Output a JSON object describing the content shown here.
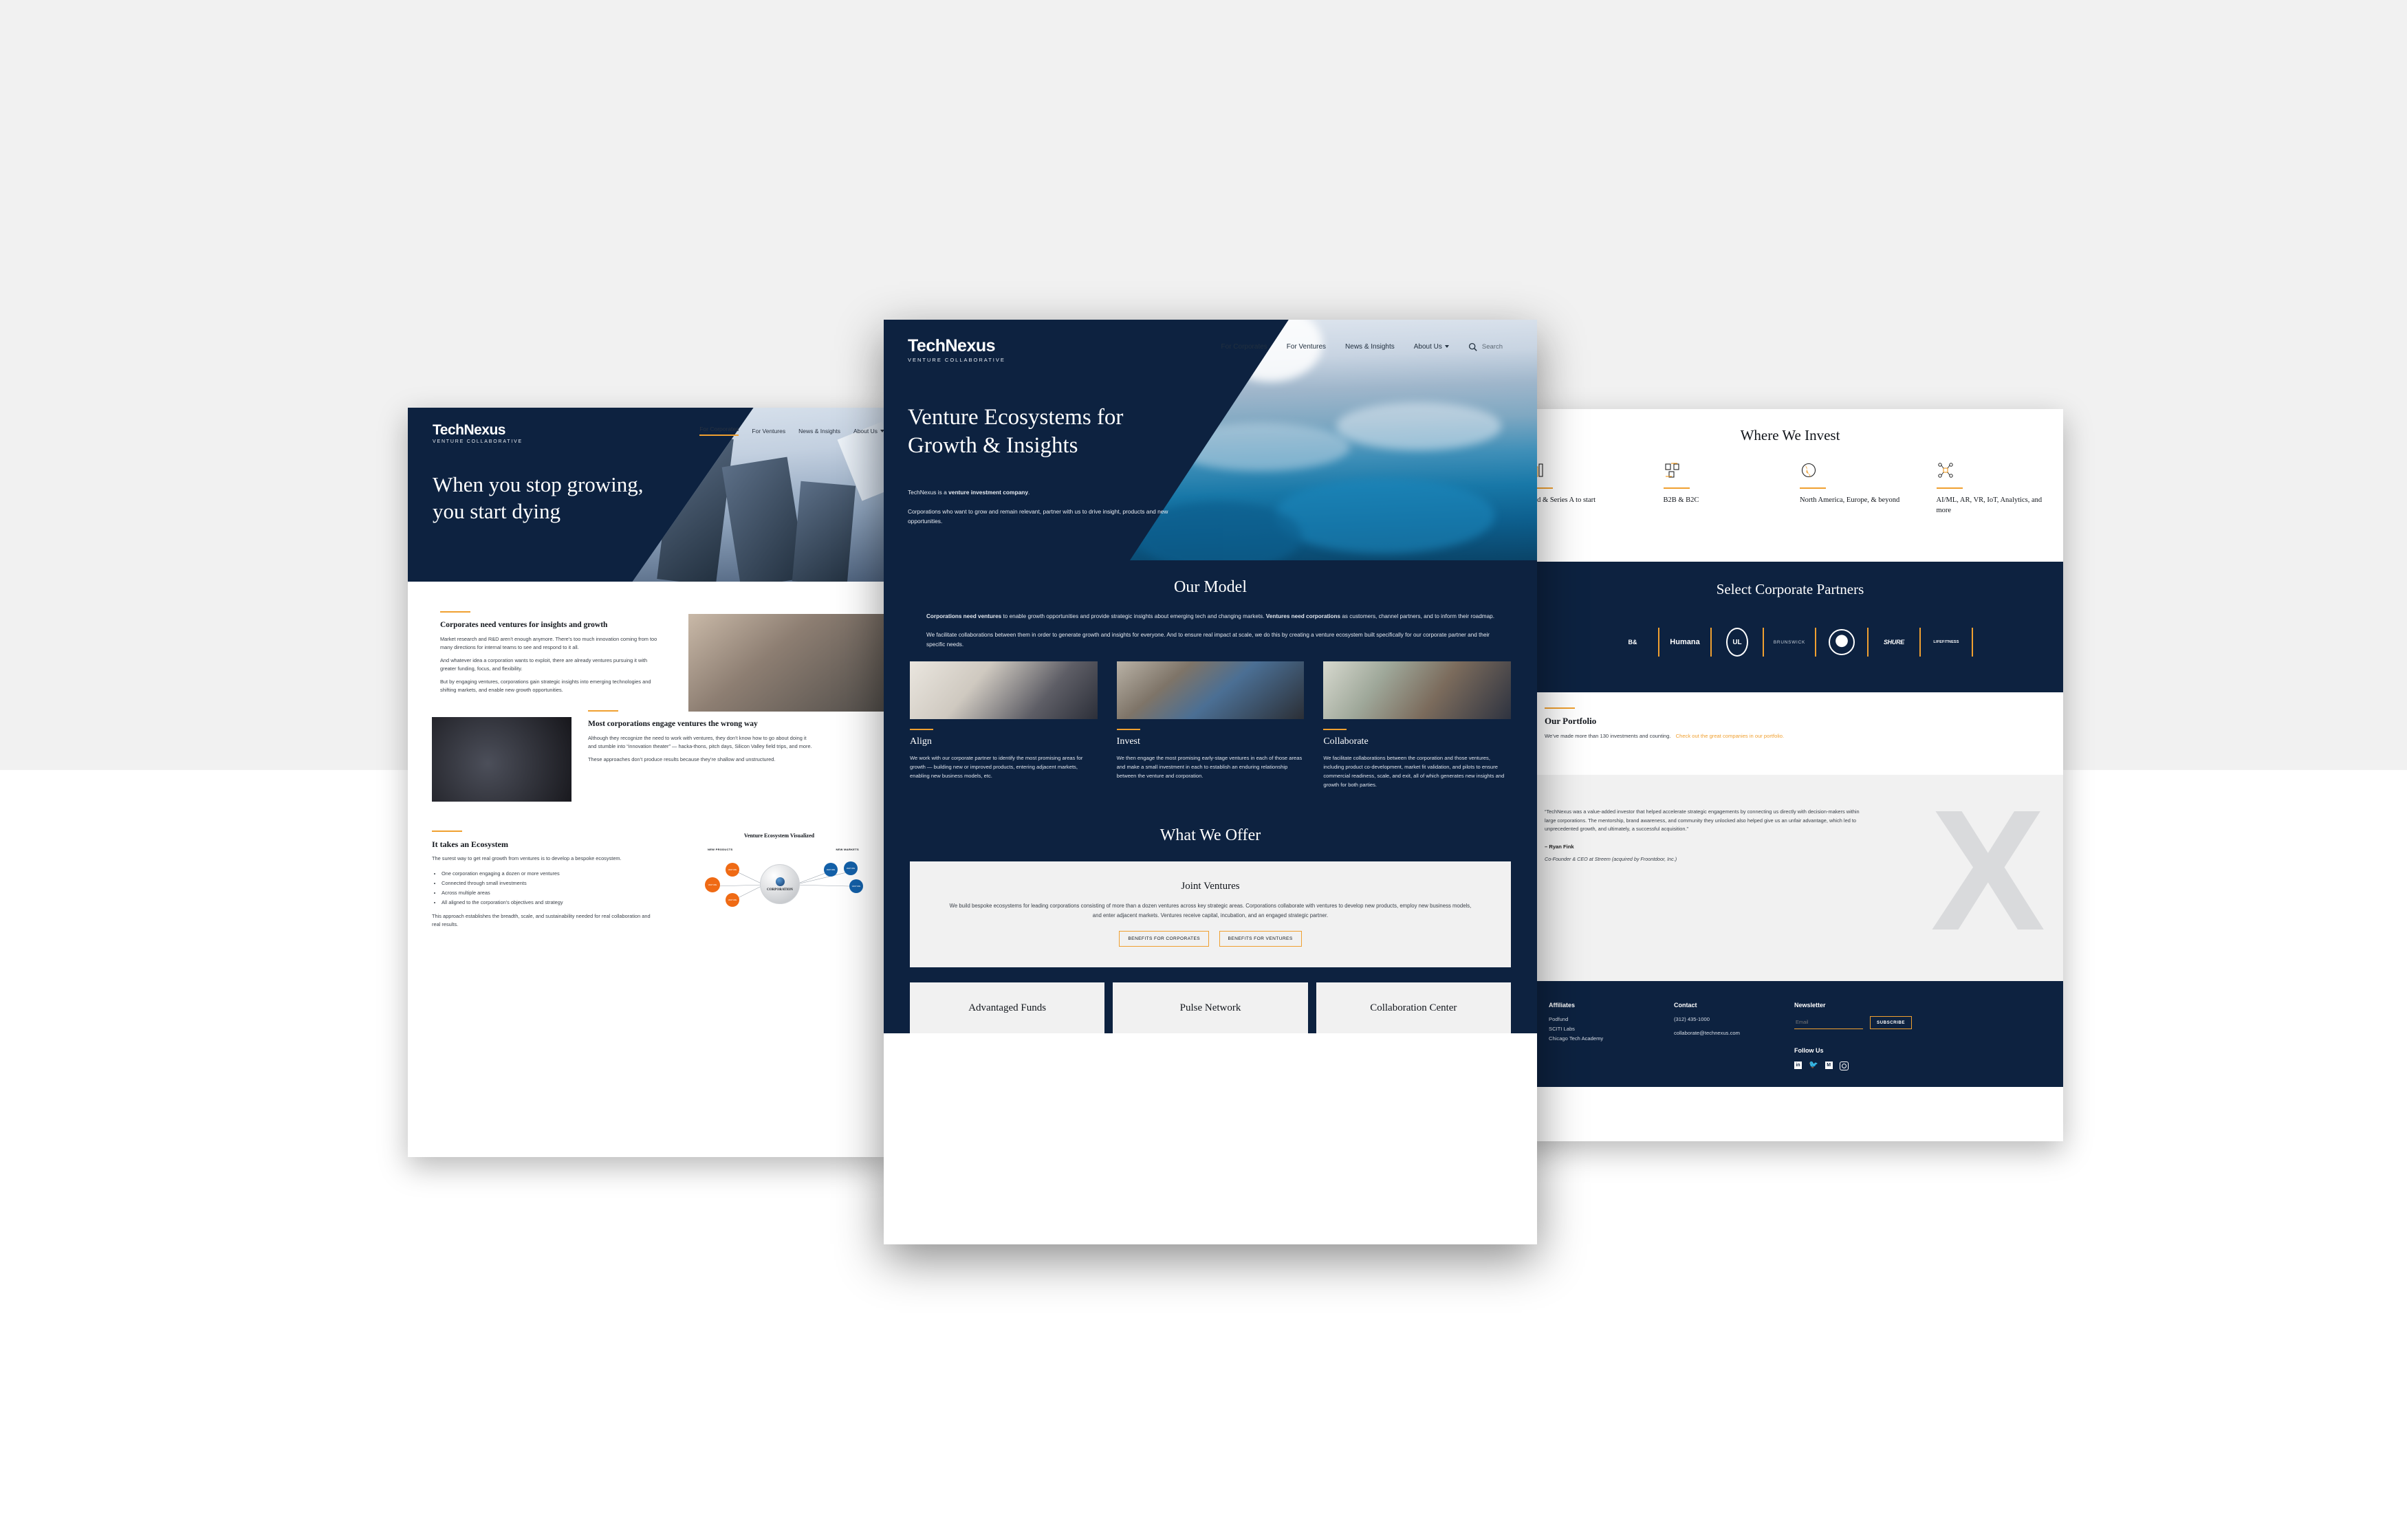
{
  "brand": {
    "name": "TechNexus",
    "tagline": "VENTURE COLLABORATIVE",
    "navy": "#0d2240",
    "accent": "#f0a030"
  },
  "nav": {
    "items": [
      "For Corporates",
      "For Ventures",
      "News & Insights",
      "About Us"
    ],
    "search_placeholder": "Search",
    "search_icon": "search-icon",
    "dropdown_icon": "chevron-down-icon"
  },
  "left_page": {
    "hero_title": "When you stop growing, you start dying",
    "active_nav": "For Corporates",
    "sections": [
      {
        "heading": "Corporates need ventures for insights and growth",
        "paragraphs": [
          "Market research and R&D aren’t enough anymore.  There’s too much innovation coming from too many directions for internal teams to see and respond to it all.",
          "And whatever idea a corporation wants to exploit, there are already ventures pursuing it with greater funding, focus, and flexibility.",
          "But by engaging ventures, corporations gain strategic insights into emerging technologies and shifting markets, and enable new growth opportunities."
        ]
      },
      {
        "heading": "Most corporations engage ventures the wrong way",
        "paragraphs": [
          "Although they recognize the need to work with ventures, they don’t know how to go about doing it and stumble into “innovation theater” — hacka-thons, pitch days, Silicon Valley field trips, and more.",
          "These approaches don’t produce results because they’re shallow and unstructured."
        ]
      },
      {
        "heading": "It takes an Ecosystem",
        "paragraphs": [
          "The surest way to get real growth from ventures is to develop a bespoke ecosystem."
        ],
        "bullets": [
          "One corporation engaging a dozen or more ventures",
          "Connected through small investments",
          "Across multiple areas",
          "All aligned to the corporation’s objectives and strategy"
        ],
        "closing": "This approach establishes the breadth, scale, and sustainability needed for real collaboration and real results."
      }
    ],
    "diagram": {
      "title": "Venture Ecosystem Visualized",
      "center_label": "CORPORATION",
      "center_icon": "globe-icon",
      "clusters": [
        {
          "label": "NEW PRODUCTS",
          "color": "#ef6a14",
          "node_label": "VENTURE",
          "count": 3
        },
        {
          "label": "NEW MARKETS",
          "color": "#1360a8",
          "node_label": "VENTURE",
          "count": 3
        }
      ]
    }
  },
  "center_page": {
    "hero": {
      "title": "Venture Ecosystems for Growth & Insights",
      "lead_prefix": "TechNexus is a ",
      "lead_bold": "venture investment company",
      "lead_suffix": ".",
      "sub": "Corporations who want to grow and remain relevant, partner with us to drive insight, products and new opportunities."
    },
    "model": {
      "heading": "Our Model",
      "para1_b1": "Corporations need ventures",
      "para1_t1": " to enable growth opportunities and provide strategic insights about emerging tech and changing markets. ",
      "para1_b2": "Ventures need corporations",
      "para1_t2": " as customers, channel partners, and to inform their roadmap.",
      "para2": "We facilitate collaborations between them in order to generate growth and insights for everyone.  And to ensure real impact at scale, we do this by creating a venture ecosystem built specifically for our corporate partner and their specific needs.",
      "columns": [
        {
          "title": "Align",
          "image": "whiteboard-photo",
          "body": "We work with our corporate partner to identify the most promising areas for growth — building new or improved products, entering adjacent markets, enabling new business models, etc."
        },
        {
          "title": "Invest",
          "image": "handshake-photo",
          "body": "We then engage the most promising early-stage ventures in each of those areas and make a small investment in each to establish an enduring relationship between the venture and corporation."
        },
        {
          "title": "Collaborate",
          "image": "sticky-notes-photo",
          "body": "We facilitate collaborations between the corporation and those ventures, including product co-development, market fit validation, and pilots to ensure commercial readiness, scale, and exit, all of which generates new insights and growth for both parties."
        }
      ]
    },
    "offer": {
      "heading": "What We Offer",
      "card": {
        "title": "Joint Ventures",
        "body": "We build bespoke ecosystems for leading corporations consisting of more than a dozen ventures across key strategic areas.  Corporations collaborate with ventures to develop new products, employ new business models, and enter adjacent markets.  Ventures receive capital, incubation, and an engaged strategic partner.",
        "buttons": [
          "BENEFITS FOR CORPORATES",
          "BENEFITS FOR VENTURES"
        ]
      },
      "mini_cards": [
        "Advantaged Funds",
        "Pulse Network",
        "Collaboration Center"
      ]
    }
  },
  "right_page": {
    "invest": {
      "heading": "Where We Invest",
      "columns": [
        {
          "icon": "stage-icon",
          "label": "Seed & Series A to start"
        },
        {
          "icon": "b2b-exchange-icon",
          "label": "B2B & B2C"
        },
        {
          "icon": "globe-icon",
          "label": "North America, Europe, & beyond"
        },
        {
          "icon": "network-nodes-icon",
          "label": "AI/ML, AR, VR, IoT, Analytics, and more"
        }
      ]
    },
    "partners": {
      "heading": "Select Corporate Partners",
      "logos": [
        "B&",
        "Humana",
        "UL",
        "BRUNSWICK",
        "DHS",
        "SHURE",
        "LIFEFITNESS"
      ]
    },
    "portfolio": {
      "heading": "Our Portfolio",
      "text": "We’ve made more than 130 investments and counting.",
      "link": "Check out the great companies in our portfolio."
    },
    "quote": {
      "text": "“TechNexus was a value-added investor that helped accelerate strategic engagements by connecting us directly with decision-makers within large corporations. The mentorship, brand awareness, and community they unlocked also helped give us an unfair advantage, which led to unprecedented growth, and ultimately, a successful acquisition.”",
      "author": "– Ryan Fink",
      "role": "Co-Founder & CEO at Streem (acquired by Froontdoor, Inc.)",
      "watermark": "X"
    },
    "footer": {
      "affiliates": {
        "heading": "Affiliates",
        "items": [
          "Podfund",
          "SCITI Labs",
          "Chicago Tech Academy"
        ]
      },
      "contact": {
        "heading": "Contact",
        "phone": "(312) 435-1000",
        "email": "collaborate@technexus.com"
      },
      "newsletter": {
        "heading": "Newsletter",
        "email_placeholder": "Email",
        "email_value": "",
        "subscribe_label": "SUBSCRIBE"
      },
      "follow": {
        "heading": "Follow Us",
        "icons": [
          "linkedin-icon",
          "twitter-icon",
          "medium-icon",
          "instagram-icon"
        ]
      }
    }
  }
}
